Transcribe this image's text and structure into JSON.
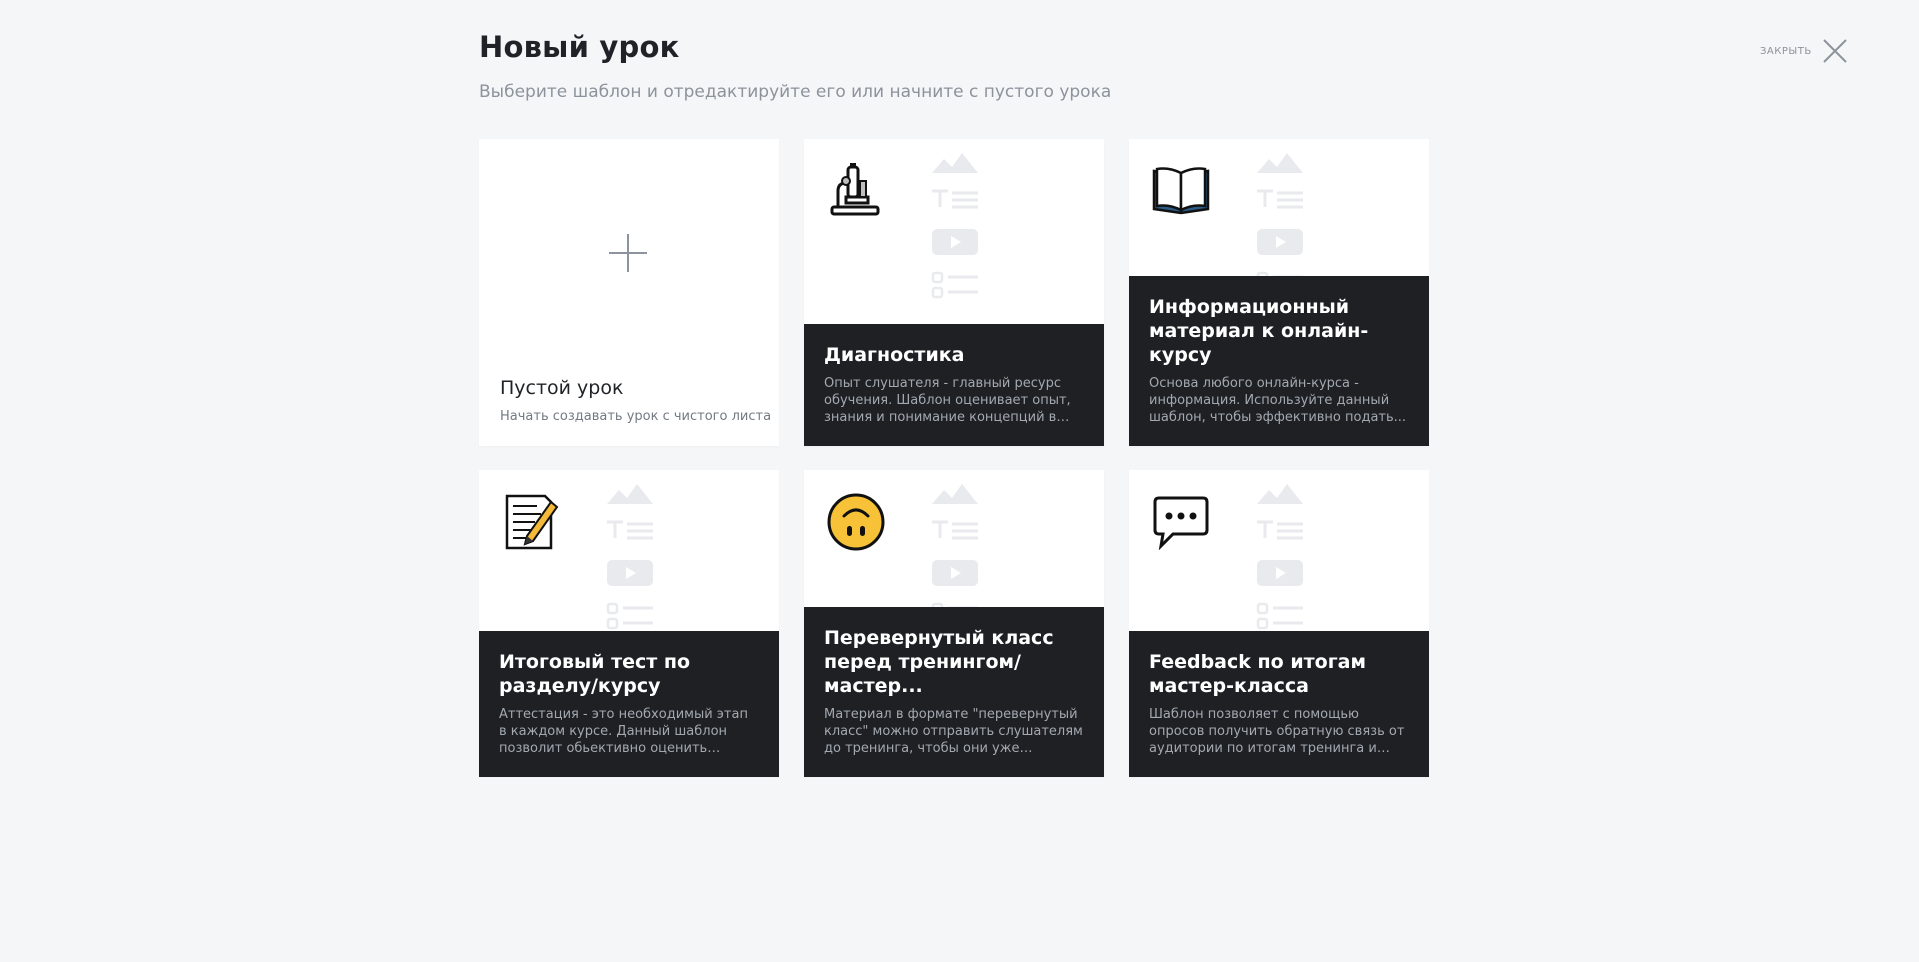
{
  "header": {
    "title": "Новый урок",
    "subtitle": "Выберите шаблон и отредактируйте его или начните с пустого урока"
  },
  "close": {
    "label": "ЗАКРЫТЬ",
    "icon": "close-icon"
  },
  "blank_card": {
    "title": "Пустой урок",
    "description": "Начать создавать урок с чистого листа",
    "icon": "plus-icon"
  },
  "templates": [
    {
      "title": "Диагностика",
      "description": "Опыт слушателя - главный ресурс обучения. Шаблон оценивает опыт, знания и понимание концепций в начал...",
      "icon": "microscope-icon"
    },
    {
      "title": "Информационный материал к онлайн-курсу",
      "description": "Основа любого онлайн-курса - информация. Используйте данный шаблон, чтобы эффективно подать...",
      "icon": "open-book-icon"
    },
    {
      "title": "Итоговый тест по разделу/курсу",
      "description": "Аттестация - это необходимый этап в каждом курсе. Данный шаблон позволит обьективно оценить прирост знаний...",
      "icon": "memo-icon"
    },
    {
      "title": "Перевернутый класс перед тренингом/мастер...",
      "description": "Материал в формате \"перевернутый класс\" можно отправить слушателям до тренинга, чтобы они уже обладали...",
      "icon": "upside-down-face-icon"
    },
    {
      "title": "Feedback по итогам мастер-класса",
      "description": "Шаблон позволяет с помощью опросов получить обратную связь от аудитории по итогам тренинга и указать задание.",
      "icon": "speech-bubble-icon"
    }
  ],
  "colors": {
    "background": "#f5f6f8",
    "card": "#ffffff",
    "panel": "#1e2024",
    "muted": "#8c939c"
  }
}
